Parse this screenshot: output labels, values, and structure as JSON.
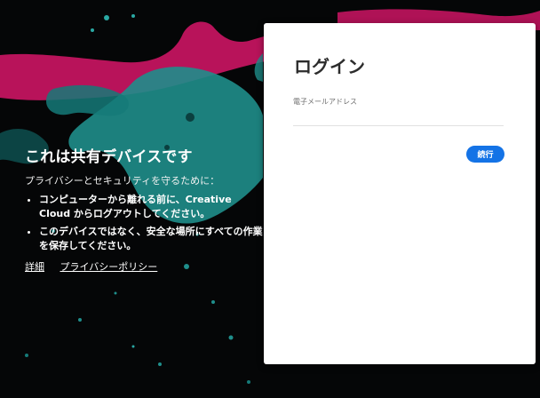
{
  "colors": {
    "background": "#050607",
    "paint_magenta": "#c2145f",
    "paint_teal": "#1f8e8b",
    "panel_background": "#ffffff",
    "primary_button": "#1473e6"
  },
  "shared_device_info": {
    "title": "これは共有デバイスです",
    "subtitle": "プライバシーとセキュリティを守るために：",
    "bullets": [
      "コンピューターから離れる前に、Creative Cloud からログアウトしてください。",
      "このデバイスではなく、安全な場所にすべての作業を保存してください。"
    ],
    "links": {
      "details": "詳細",
      "privacy_policy": "プライバシーポリシー"
    }
  },
  "login": {
    "title": "ログイン",
    "email_label": "電子メールアドレス",
    "email_value": "",
    "email_placeholder": "",
    "continue_button": "続行"
  }
}
